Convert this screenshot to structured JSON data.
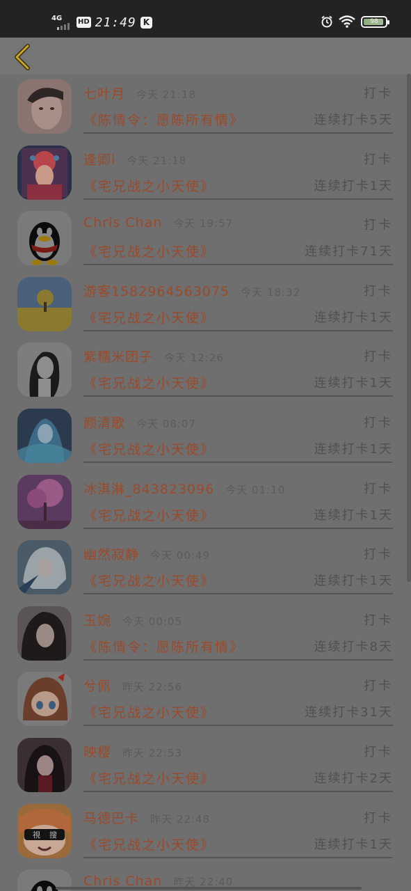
{
  "status": {
    "network": "4G",
    "hd": "HD",
    "time": "21:49",
    "k_badge": "K",
    "battery_level": "98"
  },
  "topbar": {
    "back_icon": "chevron-left-icon",
    "accent": "#c9a42c"
  },
  "entries": [
    {
      "name": "七叶月",
      "time": "今天 21:18",
      "action": "打卡",
      "book": "《陈情令：愿陈所有情》",
      "streak": "连续打卡5天",
      "avatar": "portrait-young-man"
    },
    {
      "name": "逢卿i",
      "time": "今天 21:18",
      "action": "打卡",
      "book": "《宅兄战之小天使》",
      "streak": "连续打卡1天",
      "avatar": "opera-costume"
    },
    {
      "name": "Chris Chan",
      "time": "今天 19:57",
      "action": "打卡",
      "book": "《宅兄战之小天使》",
      "streak": "连续打卡71天",
      "avatar": "qq-penguin"
    },
    {
      "name": "游客1582964563075",
      "time": "今天 18:32",
      "action": "打卡",
      "book": "《宅兄战之小天使》",
      "streak": "连续打卡1天",
      "avatar": "tree-landscape"
    },
    {
      "name": "紫糯米团子",
      "time": "今天 12:26",
      "action": "打卡",
      "book": "《宅兄战之小天使》",
      "streak": "连续打卡1天",
      "avatar": "sketch-girl"
    },
    {
      "name": "颜清歌",
      "time": "今天 08:07",
      "action": "打卡",
      "book": "《宅兄战之小天使》",
      "streak": "连续打卡1天",
      "avatar": "anime-blue"
    },
    {
      "name": "冰淇淋_843823096",
      "time": "今天 01:10",
      "action": "打卡",
      "book": "《宅兄战之小天使》",
      "streak": "连续打卡1天",
      "avatar": "pink-blossom"
    },
    {
      "name": "幽然寂静",
      "time": "今天 00:49",
      "action": "打卡",
      "book": "《宅兄战之小天使》",
      "streak": "连续打卡1天",
      "avatar": "anime-white-hair"
    },
    {
      "name": "玉婉",
      "time": "今天 00:05",
      "action": "打卡",
      "book": "《陈情令：愿陈所有情》",
      "streak": "连续打卡8天",
      "avatar": "dark-hair-girl"
    },
    {
      "name": "兮佩",
      "time": "昨天 22:56",
      "action": "打卡",
      "book": "《宅兄战之小天使》",
      "streak": "连续打卡31天",
      "avatar": "anime-brown-hair"
    },
    {
      "name": "映樱",
      "time": "昨天 22:53",
      "action": "打卡",
      "book": "《宅兄战之小天使》",
      "streak": "连续打卡2天",
      "avatar": "anime-dark-girl"
    },
    {
      "name": "马德巴卡",
      "time": "昨天 22:48",
      "action": "打卡",
      "book": "《宅兄战之小天使》",
      "streak": "连续打卡1天",
      "avatar": "umaru-sunglasses"
    },
    {
      "name": "Chris Chan",
      "time": "昨天 22:40",
      "action": "",
      "book": "",
      "streak": "",
      "avatar": "qq-penguin"
    }
  ],
  "colors": {
    "name": "#9a4a2a",
    "muted": "#505050",
    "overlay": "#6f6f6f"
  }
}
